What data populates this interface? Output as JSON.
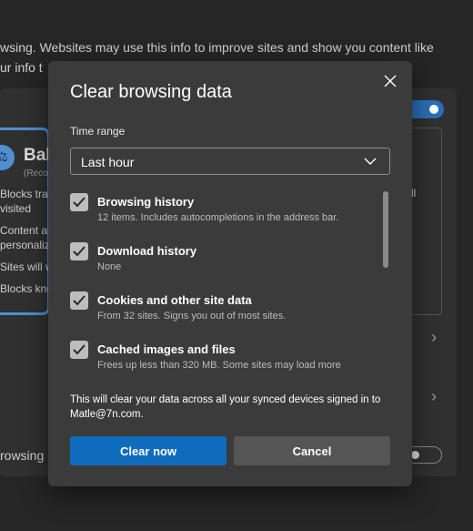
{
  "background": {
    "line1": "wsing. Websites may use this info to improve sites and show you content like",
    "line2": "ur info t",
    "balanced_title": "Bal",
    "balanced_sub": "(Reco",
    "bullets": [
      "Blocks trac",
      "visited",
      "Content an",
      "personaliz",
      "Sites will w",
      "Blocks kno"
    ],
    "strict_text": "ll",
    "bottom_label": "rowsing l"
  },
  "dialog": {
    "title": "Clear browsing data",
    "time_range_label": "Time range",
    "time_range_value": "Last hour",
    "items": [
      {
        "title": "Browsing history",
        "desc": "12 items. Includes autocompletions in the address bar.",
        "checked": true
      },
      {
        "title": "Download history",
        "desc": "None",
        "checked": true
      },
      {
        "title": "Cookies and other site data",
        "desc": "From 32 sites. Signs you out of most sites.",
        "checked": true
      },
      {
        "title": "Cached images and files",
        "desc": "Frees up less than 320 MB. Some sites may load more",
        "checked": true
      }
    ],
    "sync_note": "This will clear your data across all your synced devices signed in to Matle@7n.com.",
    "clear_label": "Clear now",
    "cancel_label": "Cancel"
  },
  "colors": {
    "primary": "#0f6cbd",
    "dialog_bg": "#3b3b3b",
    "page_bg": "#262626"
  },
  "icons": {
    "close": "close-icon",
    "dropdown": "chevron-down-icon",
    "check": "checkmark-icon"
  }
}
